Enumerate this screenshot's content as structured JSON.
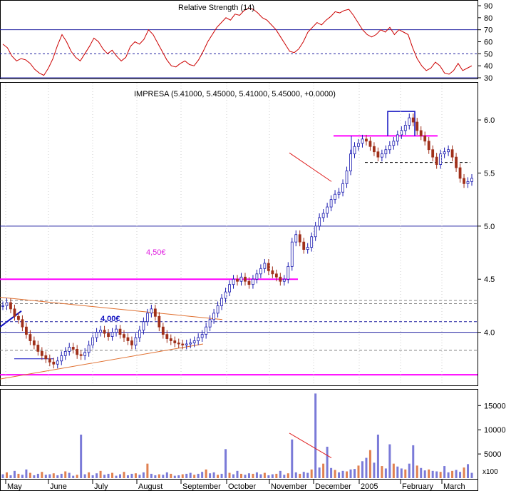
{
  "chart_data": [
    {
      "type": "line",
      "panel": "rsi",
      "title": "Relative Strength (14)",
      "ylim": [
        30,
        90
      ],
      "y_ticks": [
        30,
        40,
        50,
        60,
        70,
        80,
        90
      ],
      "reference_lines": [
        {
          "value": 70,
          "style": "solid",
          "color": "#2020a0"
        },
        {
          "value": 50,
          "style": "dashed",
          "color": "#2020a0"
        },
        {
          "value": 30,
          "style": "solid",
          "color": "#2020a0"
        }
      ],
      "series": [
        {
          "color": "#cc0000",
          "values": [
            58,
            55,
            48,
            44,
            46,
            45,
            42,
            37,
            34,
            32,
            38,
            46,
            57,
            66,
            60,
            52,
            47,
            44,
            50,
            56,
            63,
            60,
            54,
            50,
            53,
            48,
            44,
            47,
            56,
            60,
            58,
            62,
            70,
            66,
            59,
            52,
            45,
            40,
            39,
            42,
            44,
            41,
            40,
            45,
            52,
            60,
            66,
            72,
            76,
            80,
            78,
            83,
            82,
            86,
            88,
            87,
            84,
            80,
            78,
            74,
            70,
            64,
            58,
            52,
            51,
            54,
            60,
            68,
            72,
            76,
            74,
            78,
            81,
            85,
            84,
            86,
            87,
            82,
            76,
            70,
            66,
            64,
            66,
            70,
            68,
            72,
            66,
            70,
            68,
            66,
            55,
            46,
            40,
            36,
            38,
            43,
            40,
            34,
            33,
            36,
            42,
            36,
            38,
            40
          ]
        }
      ]
    },
    {
      "type": "candlestick",
      "panel": "price",
      "title": "IMPRESA (5.41000, 5.45000, 5.41000, 5.45000, +0.0000)",
      "ylim": [
        3.5,
        6.35
      ],
      "y_ticks": [
        4.0,
        4.5,
        5.0,
        5.5,
        6.0
      ],
      "x": [
        "May",
        "June",
        "July",
        "August",
        "September",
        "October",
        "November",
        "December",
        "2005",
        "February",
        "March"
      ],
      "annotations": [
        {
          "text": "4,50€",
          "color": "#e020e0"
        },
        {
          "text": "4,00€",
          "color": "#1010c0"
        }
      ],
      "horizontal_levels": [
        {
          "value": 5.0,
          "style": "solid",
          "color": "#2020a0"
        },
        {
          "value": 4.5,
          "style": "solid",
          "color": "#ff00ff"
        },
        {
          "value": 4.3,
          "style": "dashed",
          "color": "#808080"
        },
        {
          "value": 4.27,
          "style": "dashed",
          "color": "#808080"
        },
        {
          "value": 4.1,
          "style": "dashed",
          "color": "#2020a0"
        },
        {
          "value": 4.0,
          "style": "solid",
          "color": "#2020a0"
        },
        {
          "value": 3.83,
          "style": "dashed",
          "color": "#808080"
        },
        {
          "value": 3.6,
          "style": "solid",
          "color": "#ff00ff"
        },
        {
          "value": 5.85,
          "style": "solid",
          "color": "#ff00ff"
        },
        {
          "value": 5.6,
          "style": "dashed",
          "color": "#000000"
        }
      ],
      "close": [
        4.25,
        4.28,
        4.22,
        4.15,
        4.12,
        4.05,
        3.98,
        3.92,
        3.88,
        3.82,
        3.78,
        3.75,
        3.72,
        3.7,
        3.73,
        3.78,
        3.82,
        3.86,
        3.84,
        3.79,
        3.78,
        3.81,
        3.88,
        3.95,
        4.0,
        4.02,
        3.99,
        3.96,
        4.0,
        4.03,
        3.98,
        3.95,
        3.92,
        3.88,
        3.95,
        4.02,
        4.1,
        4.18,
        4.22,
        4.15,
        4.05,
        3.98,
        3.94,
        3.92,
        3.9,
        3.89,
        3.88,
        3.89,
        3.9,
        3.92,
        3.95,
        3.98,
        4.05,
        4.12,
        4.18,
        4.25,
        4.32,
        4.38,
        4.45,
        4.5,
        4.48,
        4.52,
        4.48,
        4.45,
        4.5,
        4.55,
        4.6,
        4.65,
        4.58,
        4.55,
        4.52,
        4.48,
        4.5,
        4.62,
        4.85,
        4.92,
        4.85,
        4.78,
        4.8,
        4.9,
        5.0,
        5.08,
        5.12,
        5.18,
        5.25,
        5.3,
        5.32,
        5.4,
        5.52,
        5.68,
        5.75,
        5.78,
        5.82,
        5.8,
        5.75,
        5.7,
        5.65,
        5.68,
        5.72,
        5.76,
        5.8,
        5.86,
        5.9,
        5.95,
        6.02,
        5.98,
        5.9,
        5.85,
        5.8,
        5.72,
        5.65,
        5.58,
        5.68,
        5.7,
        5.72,
        5.65,
        5.55,
        5.45,
        5.4,
        5.42,
        5.45
      ]
    },
    {
      "type": "bar",
      "panel": "volume",
      "ylim": [
        0,
        18000
      ],
      "y_ticks": [
        5000,
        10000,
        15000
      ],
      "unit_label": "x100",
      "values": [
        800,
        1200,
        600,
        1500,
        900,
        700,
        1800,
        1100,
        600,
        900,
        1300,
        700,
        800,
        1000,
        600,
        900,
        1400,
        1100,
        500,
        700,
        9000,
        800,
        1200,
        600,
        1000,
        1500,
        700,
        900,
        1100,
        500,
        800,
        1300,
        600,
        900,
        1000,
        700,
        1200,
        3000,
        900,
        600,
        800,
        700,
        1200,
        900,
        500,
        600,
        800,
        900,
        1100,
        700,
        900,
        1300,
        1800,
        1000,
        1200,
        700,
        900,
        6000,
        1100,
        800,
        1500,
        900,
        700,
        1000,
        900,
        1200,
        800,
        1100,
        600,
        800,
        900,
        1500,
        700,
        1000,
        8000,
        1200,
        900,
        1300,
        1100,
        1800,
        17500,
        2200,
        3000,
        6500,
        2100,
        1700,
        1200,
        1500,
        1400,
        1800,
        1900,
        2600,
        3500,
        4200,
        5800,
        3200,
        9000,
        2500,
        2000,
        7000,
        3000,
        2400,
        2000,
        1800,
        3000,
        6800,
        2600,
        2100,
        1600,
        1800,
        1500,
        1400,
        1300,
        2500,
        1200,
        1500,
        1700,
        1300,
        2200,
        2900,
        1100
      ]
    }
  ]
}
